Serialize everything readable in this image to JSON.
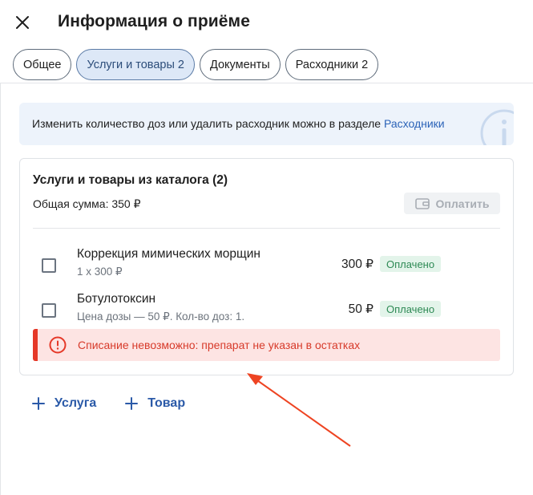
{
  "header": {
    "title": "Информация о приёме",
    "close_icon": "close-icon"
  },
  "tabs": [
    {
      "label": "Общее",
      "active": false
    },
    {
      "label": "Услуги и товары 2",
      "active": true
    },
    {
      "label": "Документы",
      "active": false
    },
    {
      "label": "Расходники 2",
      "active": false
    }
  ],
  "info_banner": {
    "text": "Изменить количество доз или удалить расходник можно в разделе ",
    "link": "Расходники",
    "icon": "info-icon"
  },
  "catalog": {
    "title": "Услуги и товары из каталога (2)",
    "total": "Общая сумма: 350 ₽",
    "pay_button": "Оплатить",
    "pay_icon": "wallet-icon",
    "items": [
      {
        "name": "Коррекция мимических морщин",
        "sub": "1 x 300 ₽",
        "price": "300 ₽",
        "status": "Оплачено"
      },
      {
        "name": "Ботулотоксин",
        "sub": "Цена дозы — 50 ₽. Кол-во доз: 1.",
        "price": "50 ₽",
        "status": "Оплачено"
      }
    ],
    "error": "Списание невозможно: препарат не указан в остатках"
  },
  "actions": {
    "add_service": "Услуга",
    "add_product": "Товар"
  },
  "colors": {
    "accent": "#2b63b8",
    "error": "#e53828",
    "success_bg": "#e3f4ea",
    "success_text": "#2e8a55",
    "annotation_arrow": "#ee4422"
  }
}
